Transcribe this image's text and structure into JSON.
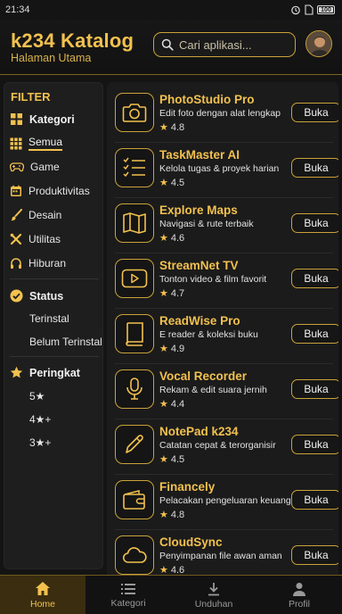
{
  "status_bar": {
    "time": "21:34",
    "battery": "100"
  },
  "header": {
    "title": "k234 Katalog",
    "subtitle": "Halaman Utama",
    "search_placeholder": "Cari aplikasi..."
  },
  "filter": {
    "title": "FILTER",
    "category_heading": "Kategori",
    "categories": [
      "Semua",
      "Game",
      "Produktivitas",
      "Desain",
      "Utilitas",
      "Hiburan"
    ],
    "selected_category": "Semua",
    "status_heading": "Status",
    "statuses": [
      "Terinstal",
      "Belum Terinstal"
    ],
    "rating_heading": "Peringkat",
    "ratings": [
      "5★",
      "4★+",
      "3★+"
    ]
  },
  "apps": [
    {
      "name": "PhotoStudio Pro",
      "desc": "Edit foto dengan alat lengkap",
      "rating": "4.8",
      "button": "Buka",
      "icon": "camera-icon"
    },
    {
      "name": "TaskMaster AI",
      "desc": "Kelola tugas & proyek harian",
      "rating": "4.5",
      "button": "Buka",
      "icon": "checklist-icon"
    },
    {
      "name": "Explore Maps",
      "desc": "Navigasi & rute terbaik",
      "rating": "4.6",
      "button": "Buka",
      "icon": "map-icon"
    },
    {
      "name": "StreamNet TV",
      "desc": "Tonton video & film favorit",
      "rating": "4.7",
      "button": "Buka",
      "icon": "play-icon"
    },
    {
      "name": "ReadWise Pro",
      "desc": "E reader & koleksi buku",
      "rating": "4.9",
      "button": "Buka",
      "icon": "book-icon"
    },
    {
      "name": "Vocal Recorder",
      "desc": "Rekam & edit suara jernih",
      "rating": "4.4",
      "button": "Buka",
      "icon": "microphone-icon"
    },
    {
      "name": "NotePad k234",
      "desc": "Catatan cepat & terorganisir",
      "rating": "4.5",
      "button": "Buka",
      "icon": "pen-icon"
    },
    {
      "name": "Financely",
      "desc": "Pelacakan pengeluaran keuangan",
      "rating": "4.8",
      "button": "Buka",
      "icon": "wallet-icon"
    },
    {
      "name": "CloudSync",
      "desc": "Penyimpanan file awan aman",
      "rating": "4.6",
      "button": "Buka",
      "icon": "cloud-icon"
    }
  ],
  "bottom_nav": [
    {
      "label": "Home",
      "icon": "home-icon",
      "active": true
    },
    {
      "label": "Kategori",
      "icon": "list-icon",
      "active": false
    },
    {
      "label": "Unduhan",
      "icon": "download-icon",
      "active": false
    },
    {
      "label": "Profil",
      "icon": "person-icon",
      "active": false
    }
  ],
  "colors": {
    "accent": "#f2c14e",
    "background": "#141414",
    "panel": "#1e1e1e"
  }
}
